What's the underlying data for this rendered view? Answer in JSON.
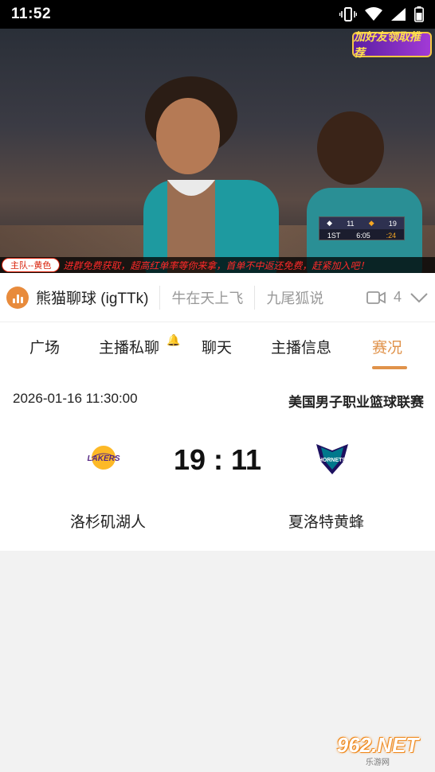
{
  "status_bar": {
    "time": "11:52",
    "icons": [
      "vibrate-icon",
      "wifi-icon",
      "signal-icon",
      "battery-icon"
    ]
  },
  "video": {
    "promo_badge": "加好友领取推荐",
    "scorebug": {
      "team1_score": "11",
      "team2_score": "19",
      "quarter": "1ST",
      "clock": "6:05",
      "shot_clock": ":24"
    },
    "ticker_tag": "主队--黄色",
    "ticker_text": "进群免费获取，超高红单率等你来拿，首单不中返还免费，赶紧加入吧！"
  },
  "info_bar": {
    "room_name": "熊猫聊球 (igTTk)",
    "other_rooms": [
      "牛在天上飞",
      "九尾狐说"
    ],
    "viewer_count": "4"
  },
  "tabs": [
    {
      "label": "广场"
    },
    {
      "label": "主播私聊"
    },
    {
      "label": "聊天"
    },
    {
      "label": "主播信息"
    },
    {
      "label": "赛况"
    }
  ],
  "match": {
    "datetime": "2026-01-16 11:30:00",
    "league": "美国男子职业篮球联赛",
    "score": "19 : 11",
    "home_team": "洛杉矶湖人",
    "away_team": "夏洛特黄蜂",
    "home_logo_text": "LAKERS",
    "away_logo_text": "HORNETS"
  },
  "watermark": {
    "main": "962.NET",
    "sub": "乐游网"
  },
  "colors": {
    "accent": "#e0924a",
    "lakers_purple": "#552583",
    "lakers_gold": "#fdb927",
    "hornets_teal": "#00788c",
    "hornets_purple": "#1d1160"
  }
}
